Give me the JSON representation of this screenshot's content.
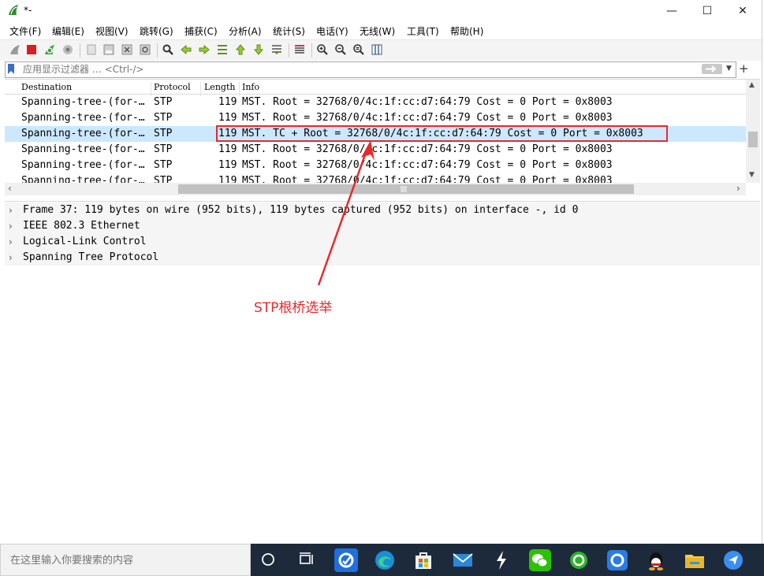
{
  "window": {
    "title": "*-",
    "controls": {
      "minimize": "—",
      "maximize": "☐",
      "close": "✕"
    }
  },
  "menu": [
    {
      "label": "文件(F)"
    },
    {
      "label": "编辑(E)"
    },
    {
      "label": "视图(V)"
    },
    {
      "label": "跳转(G)"
    },
    {
      "label": "捕获(C)"
    },
    {
      "label": "分析(A)"
    },
    {
      "label": "统计(S)"
    },
    {
      "label": "电话(Y)"
    },
    {
      "label": "无线(W)"
    },
    {
      "label": "工具(T)"
    },
    {
      "label": "帮助(H)"
    }
  ],
  "filter": {
    "placeholder": "应用显示过滤器 … <Ctrl-/>",
    "add_label": "+",
    "dropdown_label": "▼"
  },
  "packet_list": {
    "columns": [
      "Destination",
      "Protocol",
      "Length",
      "Info"
    ],
    "rows": [
      {
        "destination": "Spanning-tree-(for-…",
        "protocol": "STP",
        "length": "119",
        "info": "MST. Root = 32768/0/4c:1f:cc:d7:64:79  Cost = 0  Port = 0x8003"
      },
      {
        "destination": "Spanning-tree-(for-…",
        "protocol": "STP",
        "length": "119",
        "info": "MST. Root = 32768/0/4c:1f:cc:d7:64:79  Cost = 0  Port = 0x8003"
      },
      {
        "destination": "Spanning-tree-(for-…",
        "protocol": "STP",
        "length": "119",
        "info": "MST. TC + Root = 32768/0/4c:1f:cc:d7:64:79  Cost = 0  Port = 0x8003"
      },
      {
        "destination": "Spanning-tree-(for-…",
        "protocol": "STP",
        "length": "119",
        "info": "MST. Root = 32768/0/4c:1f:cc:d7:64:79  Cost = 0  Port = 0x8003"
      },
      {
        "destination": "Spanning-tree-(for-…",
        "protocol": "STP",
        "length": "119",
        "info": "MST. Root = 32768/0/4c:1f:cc:d7:64:79  Cost = 0  Port = 0x8003"
      },
      {
        "destination": "Spanning-tree-(for-…",
        "protocol": "STP",
        "length": "119",
        "info": "MST. Root = 32768/0/4c:1f:cc:d7:64:79  Cost = 0  Port = 0x8003"
      }
    ],
    "selected_row": 2
  },
  "details": [
    {
      "text": "Frame 37: 119 bytes on wire (952 bits), 119 bytes captured (952 bits) on interface -, id 0"
    },
    {
      "text": "IEEE 802.3 Ethernet"
    },
    {
      "text": "Logical-Link Control"
    },
    {
      "text": "Spanning Tree Protocol"
    }
  ],
  "annotation": {
    "text": "STP根桥选举",
    "color": "#e8292b"
  },
  "taskbar": {
    "search_placeholder": "在这里输入你要搜索的内容",
    "icons": [
      "cortana-icon",
      "task-view-icon",
      "mail-app-icon",
      "edge-icon",
      "store-icon",
      "mail-icon",
      "stripe-app-icon",
      "wechat-icon",
      "green-ring-app-icon",
      "blue-app-icon",
      "qq-icon",
      "file-explorer-icon",
      "feishu-icon"
    ]
  },
  "colors": {
    "selection": "#cce8ff",
    "highlight": "#e8292b",
    "taskbar": "#1c2a3c"
  }
}
